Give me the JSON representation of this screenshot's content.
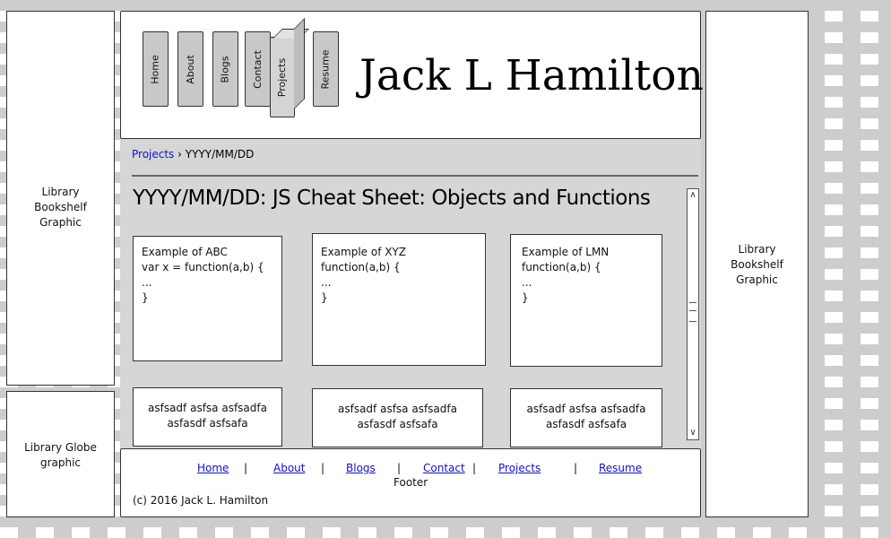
{
  "left_sidebar": {
    "bookshelf_text": "Library Bookshelf Graphic",
    "globe_text": "Library Globe graphic"
  },
  "right_sidebar": {
    "bookshelf_text": "Library Bookshelf Graphic"
  },
  "header": {
    "title": "Jack L Hamilton",
    "nav_tabs": [
      "Home",
      "About",
      "Blogs",
      "Contact",
      "Projects",
      "Resume"
    ],
    "active_tab": "Projects"
  },
  "breadcrumb": {
    "parent": "Projects",
    "separator": "›",
    "current": "YYYY/MM/DD"
  },
  "content": {
    "title": "YYYY/MM/DD: JS Cheat Sheet: Objects and Functions",
    "code_cards": [
      {
        "lines": [
          "Example of ABC",
          "var x = function(a,b) {",
          "",
          "...",
          "",
          "",
          "}"
        ]
      },
      {
        "lines": [
          "Example of XYZ",
          "function(a,b) {",
          "",
          "...",
          "",
          "",
          "}"
        ]
      },
      {
        "lines": [
          "Example of LMN",
          "function(a,b) {",
          "",
          "...",
          "",
          "",
          "}"
        ]
      }
    ],
    "text_cards": [
      {
        "line1": "asfsadf asfsa asfsadfa",
        "line2": "asfasdf asfsafa"
      },
      {
        "line1": "asfsadf asfsa asfsadfa",
        "line2": "asfasdf asfsafa"
      },
      {
        "line1": "asfsadf asfsa asfsadfa",
        "line2": "asfasdf asfsafa"
      }
    ]
  },
  "footer": {
    "links": [
      "Home",
      "About",
      "Blogs",
      "Contact",
      "Projects",
      "Resume"
    ],
    "separator": "|",
    "label": "Footer",
    "copyright": "(c) 2016 Jack L. Hamilton"
  },
  "colors": {
    "link": "#1111cc",
    "panel_border": "#333333",
    "tab_fill": "#c8c8c8",
    "checker": "#cdcdcd"
  },
  "icons": {
    "scroll_up": "chevron-up-icon",
    "scroll_down": "chevron-down-icon"
  }
}
